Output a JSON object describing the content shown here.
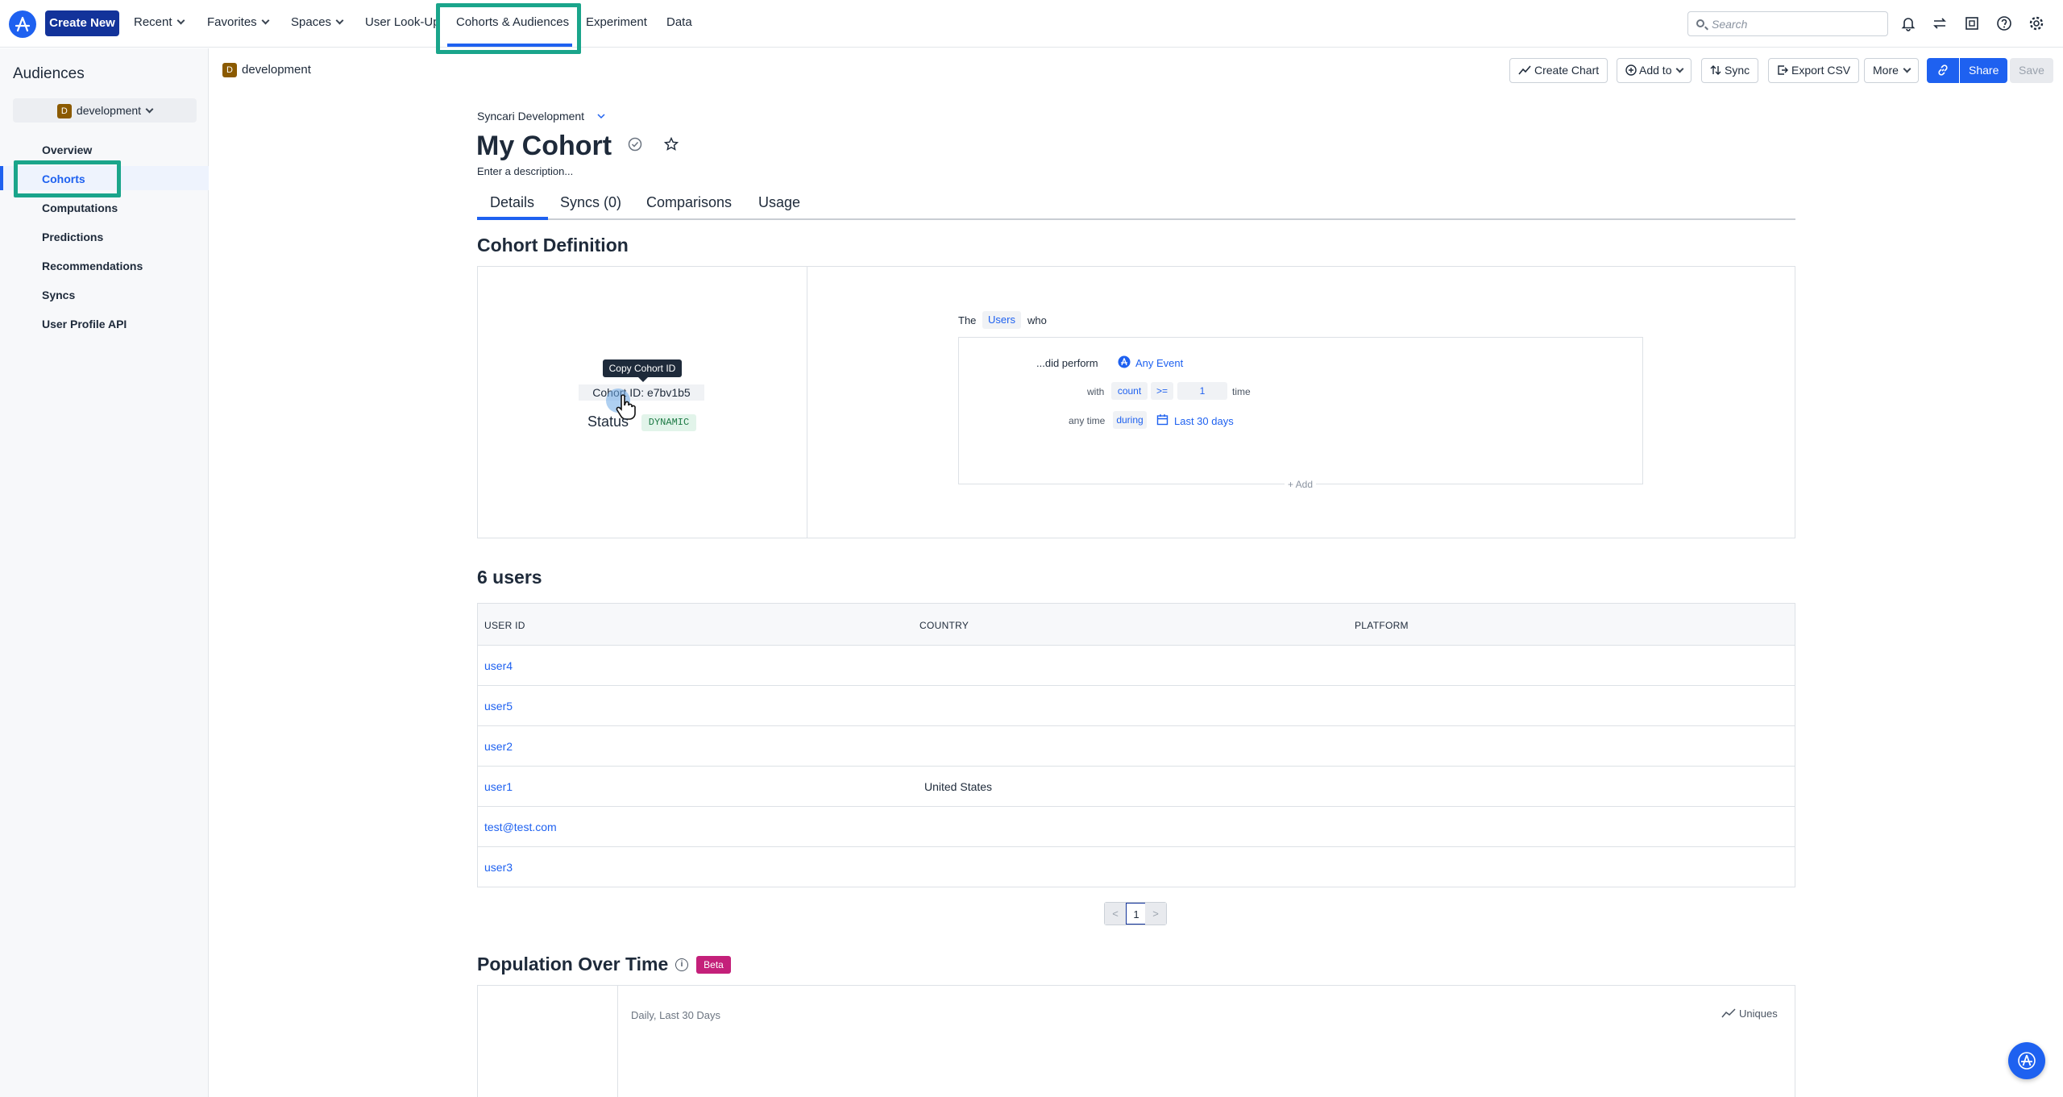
{
  "topnav": {
    "create_new": "Create New",
    "items": [
      "Recent",
      "Favorites",
      "Spaces",
      "User Look-Up",
      "Cohorts & Audiences",
      "Experiment",
      "Data"
    ],
    "search_placeholder": "Search",
    "active_item": "Cohorts & Audiences"
  },
  "sidebar": {
    "title": "Audiences",
    "workspace": "development",
    "workspace_badge": "D",
    "items": [
      "Overview",
      "Cohorts",
      "Computations",
      "Predictions",
      "Recommendations",
      "Syncs",
      "User Profile API"
    ],
    "active_item": "Cohorts"
  },
  "subheader": {
    "badge": "D",
    "project": "development",
    "buttons": {
      "create_chart": "Create Chart",
      "add_to": "Add to",
      "sync": "Sync",
      "export_csv": "Export CSV",
      "more": "More",
      "share": "Share",
      "save": "Save"
    }
  },
  "cohort": {
    "breadcrumb": "Syncari Development",
    "title": "My Cohort",
    "description": "Enter a description...",
    "tabs": [
      "Details",
      "Syncs (0)",
      "Comparisons",
      "Usage"
    ],
    "active_tab": "Details"
  },
  "definition": {
    "section_title": "Cohort Definition",
    "tooltip": "Copy Cohort ID",
    "cohort_id_label": "Cohort ID:",
    "cohort_id_value": "e7bv1b5",
    "status_label": "Status",
    "status_value": "DYNAMIC",
    "rule": {
      "the": "The",
      "entity": "Users",
      "who": "who",
      "did_perform": "...did perform",
      "event": "Any Event",
      "with": "with",
      "count": "count",
      "op": ">=",
      "value": "1",
      "time": "time",
      "any_time": "any time",
      "during": "during",
      "range": "Last 30 days",
      "add": "+ Add"
    }
  },
  "users": {
    "section_title": "6 users",
    "columns": [
      "USER ID",
      "COUNTRY",
      "PLATFORM"
    ],
    "rows": [
      {
        "user_id": "user4",
        "country": "",
        "platform": ""
      },
      {
        "user_id": "user5",
        "country": "",
        "platform": ""
      },
      {
        "user_id": "user2",
        "country": "",
        "platform": ""
      },
      {
        "user_id": "user1",
        "country": "United States",
        "platform": ""
      },
      {
        "user_id": "test@test.com",
        "country": "",
        "platform": ""
      },
      {
        "user_id": "user3",
        "country": "",
        "platform": ""
      }
    ],
    "pager": {
      "prev": "<",
      "page": "1",
      "next": ">"
    }
  },
  "population": {
    "section_title": "Population Over Time",
    "badge": "Beta",
    "subtitle": "Daily, Last 30 Days",
    "metric": "Uniques"
  },
  "colors": {
    "accent": "#1e61f0",
    "brand_dark": "#13339a",
    "highlight_annotation": "#1aa58b",
    "beta": "#c4207a"
  }
}
